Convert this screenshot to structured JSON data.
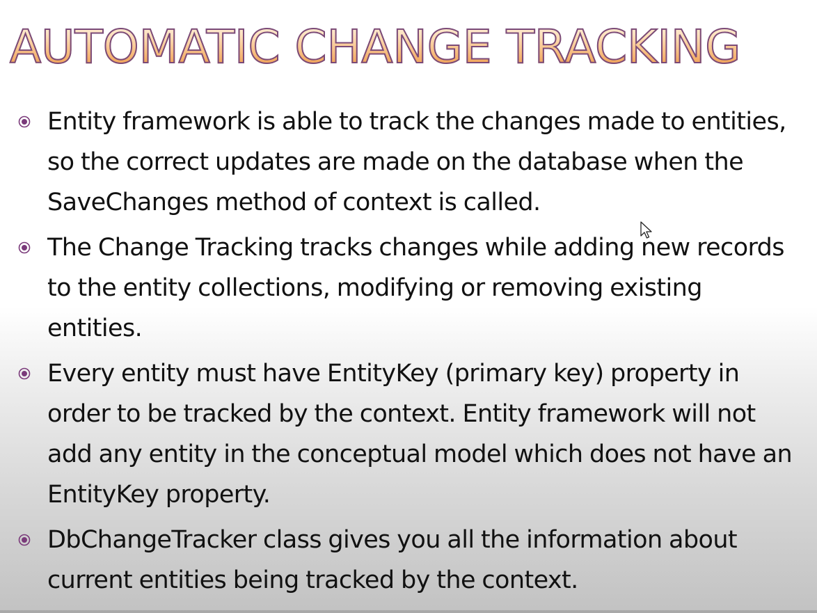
{
  "slide": {
    "title": "AUTOMATIC CHANGE TRACKING",
    "bullet_icon": "circle-dot-bullet-icon",
    "accent_color": "#7a3a7a",
    "title_gradient": [
      "#fffaf2",
      "#f7bd80",
      "#e68a3a"
    ],
    "bullets": [
      "Entity framework is able to track the changes made to entities, so the correct updates are made on the database when the SaveChanges method of context is called.",
      "The Change Tracking tracks changes while adding new records to the entity collections, modifying or removing existing entities.",
      "Every entity must have EntityKey (primary key) property in order to be tracked by the context. Entity framework will not add any entity in the conceptual model which does not have an EntityKey property.",
      "DbChangeTracker class gives you all the information about current entities being tracked by the context."
    ]
  },
  "cursor_icon": "mouse-pointer-icon"
}
